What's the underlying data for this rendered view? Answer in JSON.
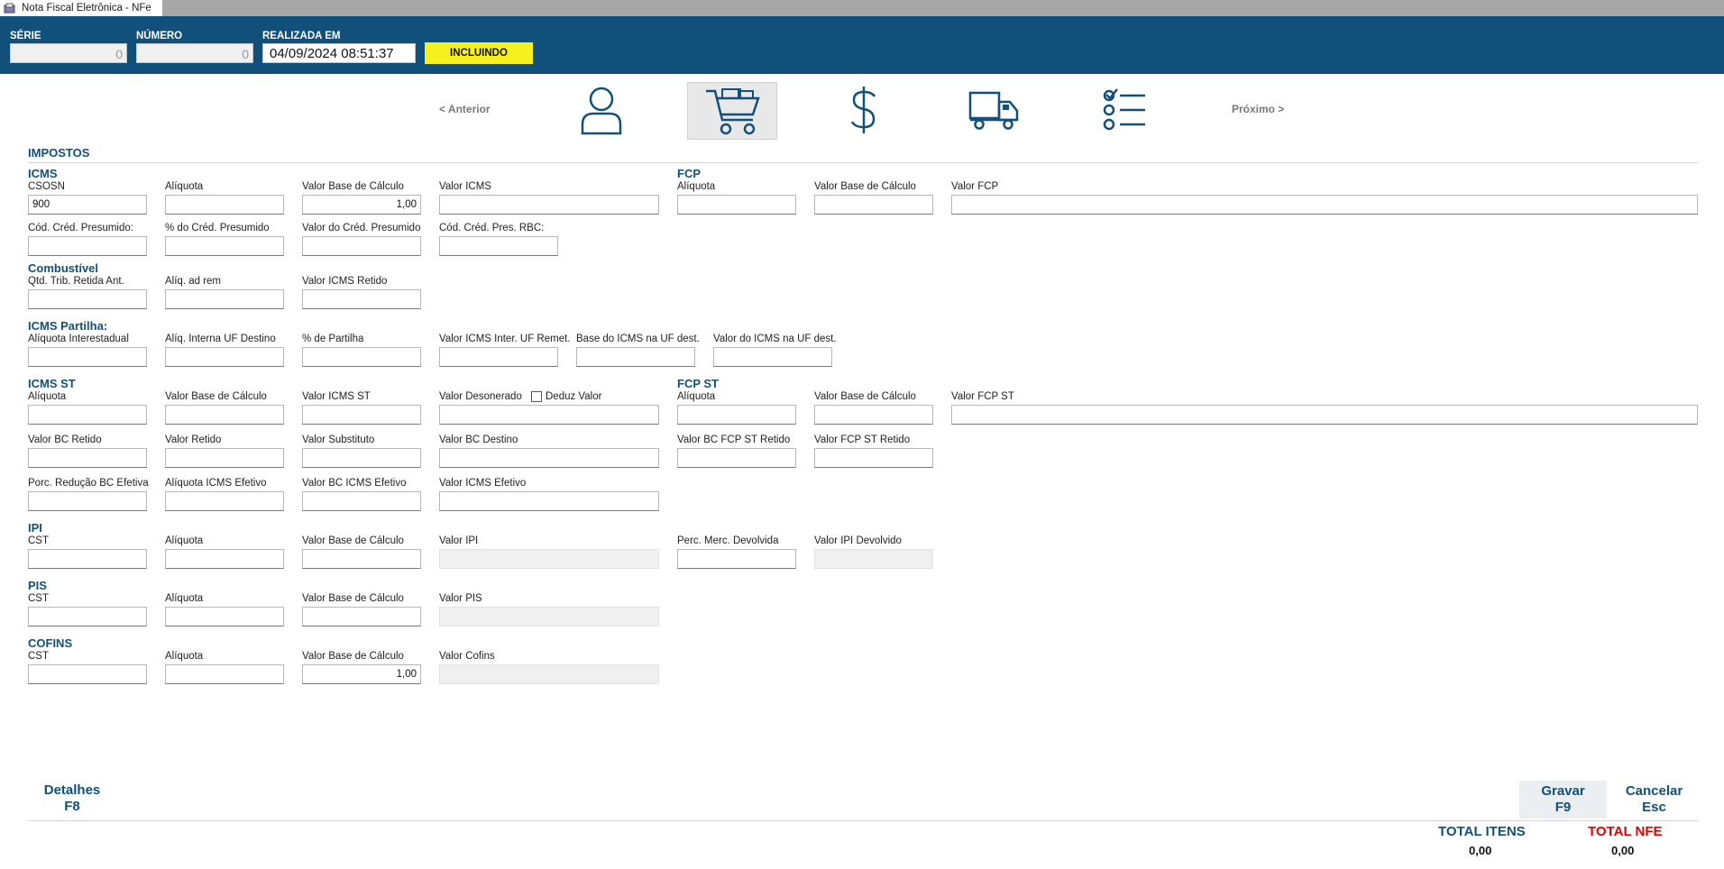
{
  "window": {
    "title": "Nota Fiscal Eletrônica - NFe"
  },
  "header": {
    "serie_label": "SÉRIE",
    "serie_value": "0",
    "numero_label": "NÚMERO",
    "numero_value": "0",
    "realizada_label": "REALIZADA EM",
    "realizada_value": "04/09/2024 08:51:37",
    "status": "INCLUINDO"
  },
  "nav": {
    "prev": "< Anterior",
    "next": "Próximo >",
    "steps": [
      "user-icon",
      "cart-icon",
      "dollar-icon",
      "truck-icon",
      "checklist-icon"
    ],
    "active_step": "cart-icon"
  },
  "impostos": {
    "title": "IMPOSTOS",
    "icms": {
      "title": "ICMS",
      "csosn_label": "CSOSN",
      "csosn_value": "900",
      "aliquota_label": "Alíquota",
      "base_label": "Valor Base de Cálculo",
      "base_value": "1,00",
      "valor_label": "Valor ICMS",
      "cod_cred_label": "Cód. Créd. Presumido:",
      "perc_cred_label": "% do Créd. Presumido",
      "valor_cred_label": "Valor do Créd. Presumido",
      "cod_rbc_label": "Cód. Créd. Pres. RBC:"
    },
    "fcp": {
      "title": "FCP",
      "aliquota_label": "Alíquota",
      "base_label": "Valor Base de Cálculo",
      "valor_label": "Valor FCP"
    },
    "combustivel": {
      "title": "Combustível",
      "qtd_label": "Qtd. Trib. Retida Ant.",
      "aliq_label": "Alíq. ad rem",
      "valor_label": "Valor ICMS Retido"
    },
    "partilha": {
      "title": "ICMS Partilha:",
      "aliq_inter_label": "Alíquota Interestadual",
      "aliq_interna_label": "Alíq. Interna UF Destino",
      "perc_label": "% de Partilha",
      "valor_inter_label": "Valor ICMS Inter. UF Remet.",
      "base_dest_label": "Base do ICMS na UF dest.",
      "valor_dest_label": "Valor do ICMS na UF dest."
    },
    "icms_st": {
      "title": "ICMS ST",
      "aliquota_label": "Alíquota",
      "base_label": "Valor Base de Cálculo",
      "valor_label": "Valor ICMS ST",
      "desonerado_label": "Valor Desonerado",
      "deduz_label": "Deduz Valor",
      "bc_retido_label": "Valor BC Retido",
      "retido_label": "Valor Retido",
      "substituto_label": "Valor Substituto",
      "bc_destino_label": "Valor BC Destino",
      "porc_reducao_label": "Porc. Redução BC Efetiva",
      "aliq_efetivo_label": "Alíquota ICMS Efetivo",
      "bc_efetivo_label": "Valor BC ICMS Efetivo",
      "valor_efetivo_label": "Valor ICMS Efetivo"
    },
    "fcp_st": {
      "title": "FCP ST",
      "aliquota_label": "Alíquota",
      "base_label": "Valor Base de Cálculo",
      "valor_label": "Valor FCP ST",
      "bc_retido_label": "Valor BC FCP ST Retido",
      "retido_label": "Valor FCP ST Retido"
    },
    "ipi": {
      "title": "IPI",
      "cst_label": "CST",
      "aliquota_label": "Alíquota",
      "base_label": "Valor Base de Cálculo",
      "valor_label": "Valor IPI",
      "perc_merc_label": "Perc. Merc. Devolvida",
      "devolvido_label": "Valor IPI Devolvido"
    },
    "pis": {
      "title": "PIS",
      "cst_label": "CST",
      "aliquota_label": "Alíquota",
      "base_label": "Valor Base de Cálculo",
      "valor_label": "Valor PIS"
    },
    "cofins": {
      "title": "COFINS",
      "cst_label": "CST",
      "aliquota_label": "Alíquota",
      "base_label": "Valor Base de Cálculo",
      "base_value": "1,00",
      "valor_label": "Valor Cofins"
    }
  },
  "footer": {
    "detalhes": "Detalhes",
    "detalhes_key": "F8",
    "gravar": "Gravar",
    "gravar_key": "F9",
    "cancelar": "Cancelar",
    "cancelar_key": "Esc",
    "total_itens_label": "TOTAL ITENS",
    "total_itens_value": "0,00",
    "total_nfe_label": "TOTAL NFE",
    "total_nfe_value": "0,00",
    "total_nfe_color": "#e00000",
    "brand_color": "#10507a",
    "status_color": "#f5f01e"
  }
}
